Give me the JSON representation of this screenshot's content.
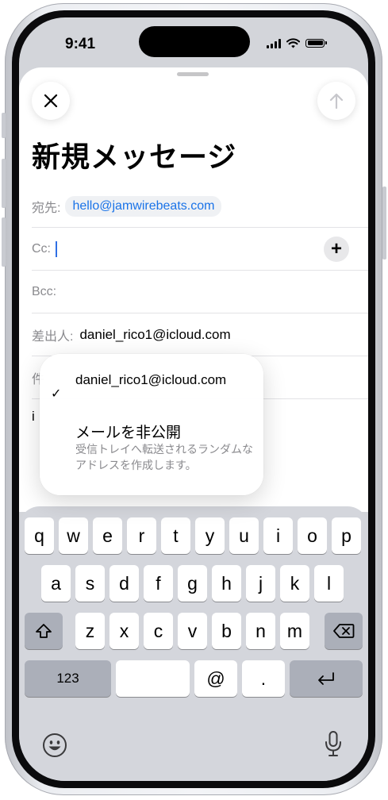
{
  "status_bar": {
    "time": "9:41"
  },
  "compose": {
    "title": "新規メッセージ",
    "to_label": "宛先:",
    "to_value": "hello@jamwirebeats.com",
    "cc_label": "Cc:",
    "bcc_label": "Bcc:",
    "from_label": "差出人:",
    "from_value": "daniel_rico1@icloud.com",
    "subject_label_partial": "件",
    "body_partial": "i"
  },
  "from_menu": {
    "selected_email": "daniel_rico1@icloud.com",
    "hide_title": "メールを非公開",
    "hide_desc": "受信トレイへ転送されるランダムなアドレスを作成します。"
  },
  "keyboard": {
    "row1": [
      "q",
      "w",
      "e",
      "r",
      "t",
      "y",
      "u",
      "i",
      "o",
      "p"
    ],
    "row2": [
      "a",
      "s",
      "d",
      "f",
      "g",
      "h",
      "j",
      "k",
      "l"
    ],
    "row3": [
      "z",
      "x",
      "c",
      "v",
      "b",
      "n",
      "m"
    ],
    "numbers_key": "123",
    "at_key": "@",
    "dot_key": "."
  },
  "icons": {
    "close": "close-icon",
    "send": "arrow-up-icon",
    "add": "plus-icon",
    "shift": "shift-icon",
    "delete": "backspace-icon",
    "return": "return-icon",
    "emoji": "emoji-icon",
    "mic": "microphone-icon"
  }
}
